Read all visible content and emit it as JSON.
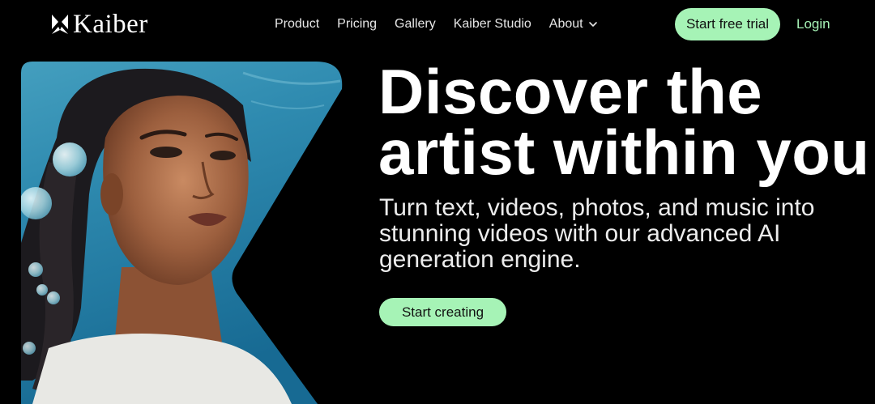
{
  "brand": {
    "name": "Kaiber",
    "logo_icon": "kaiber-logo-icon",
    "accent_color": "#a6f3b6"
  },
  "nav": {
    "links": [
      "Product",
      "Pricing",
      "Gallery",
      "Kaiber Studio"
    ],
    "about_label": "About",
    "trial_button": "Start free trial",
    "login_label": "Login"
  },
  "hero": {
    "headline_line1": "Discover the",
    "headline_line2": "artist within you",
    "subtext": "Turn text, videos, photos, and music into stunning videos with our advanced AI generation engine.",
    "cta_button": "Start creating",
    "image_subject": "ai-portrait-illustration"
  }
}
